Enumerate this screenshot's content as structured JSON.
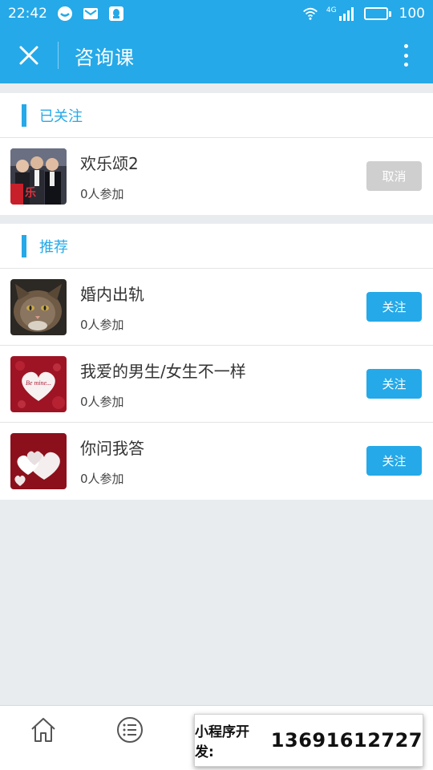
{
  "status_bar": {
    "time": "22:42",
    "network": "4G",
    "battery": "100"
  },
  "header": {
    "title": "咨询课"
  },
  "followed": {
    "title": "已关注",
    "items": [
      {
        "title": "欢乐颂2",
        "count": "0人参加",
        "action": "取消",
        "thumb_icon": "tv-drama-poster"
      }
    ]
  },
  "recommended": {
    "title": "推荐",
    "items": [
      {
        "title": "婚内出轨",
        "count": "0人参加",
        "action": "关注",
        "thumb_icon": "cat-photo"
      },
      {
        "title": "我爱的男生/女生不一样",
        "count": "0人参加",
        "action": "关注",
        "thumb_icon": "be-mine-heart"
      },
      {
        "title": "你问我答",
        "count": "0人参加",
        "action": "关注",
        "thumb_icon": "paper-hearts"
      }
    ]
  },
  "watermark": {
    "label": "小程序开发:",
    "phone": "13691612727"
  },
  "colors": {
    "accent": "#25a9e8",
    "cancel_button": "#cfcfcf",
    "background": "#e9ecef"
  }
}
